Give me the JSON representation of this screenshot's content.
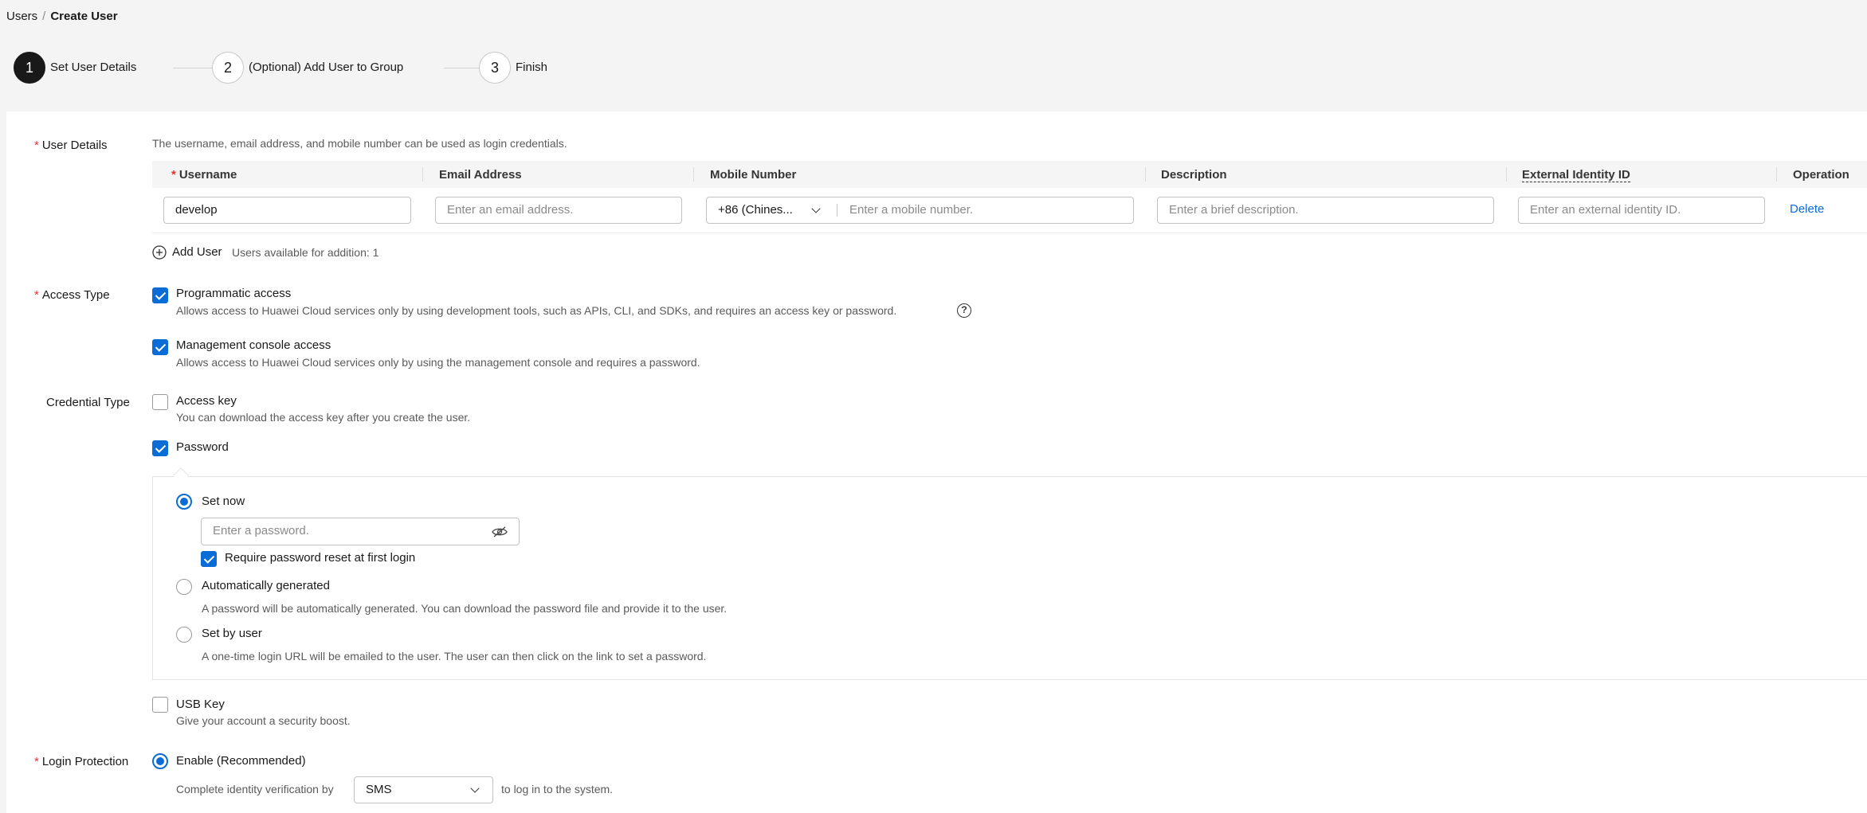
{
  "breadcrumb": {
    "parent": "Users",
    "separator": "/",
    "current": "Create User"
  },
  "steps": [
    {
      "number": "1",
      "label": "Set User Details",
      "active": true
    },
    {
      "number": "2",
      "label": "(Optional) Add User to Group",
      "active": false
    },
    {
      "number": "3",
      "label": "Finish",
      "active": false
    }
  ],
  "user_details": {
    "label": "User Details",
    "hint": "The username, email address, and mobile number can be used as login credentials.",
    "columns": {
      "username": "Username",
      "email": "Email Address",
      "mobile": "Mobile Number",
      "description": "Description",
      "external_id": "External Identity ID",
      "operation": "Operation"
    },
    "row": {
      "username": "develop",
      "email_placeholder": "Enter an email address.",
      "country_code": "+86 (Chines...",
      "mobile_placeholder": "Enter a mobile number.",
      "description_placeholder": "Enter a brief description.",
      "external_id_placeholder": "Enter an external identity ID.",
      "delete": "Delete"
    },
    "add_user": "Add User",
    "available": "Users available for addition: 1"
  },
  "access_type": {
    "label": "Access Type",
    "programmatic": {
      "title": "Programmatic access",
      "desc": "Allows access to Huawei Cloud services only by using development tools, such as APIs, CLI, and SDKs, and requires an access key or password.",
      "checked": true
    },
    "console": {
      "title": "Management console access",
      "desc": "Allows access to Huawei Cloud services only by using the management console and requires a password.",
      "checked": true
    }
  },
  "credential_type": {
    "label": "Credential Type",
    "access_key": {
      "title": "Access key",
      "desc": "You can download the access key after you create the user.",
      "checked": false
    },
    "password": {
      "title": "Password",
      "checked": true
    },
    "set_now": "Set now",
    "password_placeholder": "Enter a password.",
    "require_reset": "Require password reset at first login",
    "auto_generated": "Automatically generated",
    "auto_desc": "A password will be automatically generated. You can download the password file and provide it to the user.",
    "set_by_user": "Set by user",
    "set_by_user_desc": "A one-time login URL will be emailed to the user. The user can then click on the link to set a password.",
    "usb_key": {
      "title": "USB Key",
      "desc": "Give your account a security boost.",
      "checked": false
    }
  },
  "login_protection": {
    "label": "Login Protection",
    "enable": "Enable (Recommended)",
    "verify_prefix": "Complete identity verification by",
    "method": "SMS",
    "verify_suffix": "to log in to the system."
  },
  "colors": {
    "accent": "#0a6cd6",
    "required": "#e6322f",
    "step_active": "#191919"
  }
}
